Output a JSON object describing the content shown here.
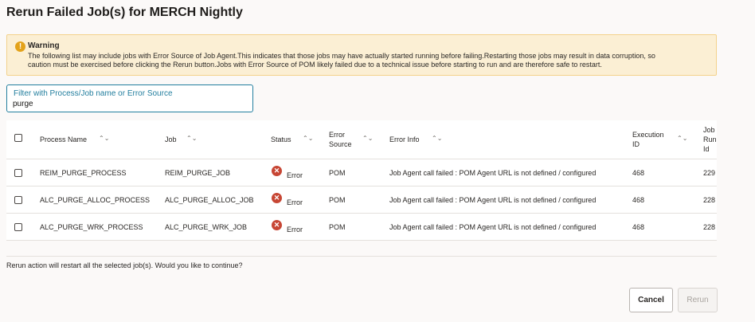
{
  "dialog": {
    "title": "Rerun Failed Job(s) for MERCH Nightly"
  },
  "warning": {
    "title": "Warning",
    "line1": "The following list may include jobs with Error Source of Job Agent.This indicates that those jobs may have actually started running before failing.Restarting those jobs may result in data corruption, so",
    "line2": "caution must be exercised before clicking the Rerun button.Jobs with Error Source of POM likely failed due to a technical issue before starting to run and are therefore safe to restart."
  },
  "filter": {
    "label": "Filter with Process/Job name or Error Source",
    "value": "purge"
  },
  "table": {
    "headers": {
      "process_name": "Process Name",
      "job": "Job",
      "status": "Status",
      "error_source_1": "Error",
      "error_source_2": "Source",
      "error_info": "Error Info",
      "execution_id_1": "Execution",
      "execution_id_2": "ID",
      "job_run_id_1": "Job",
      "job_run_id_2": "Run",
      "job_run_id_3": "Id"
    },
    "rows": [
      {
        "process_name": "REIM_PURGE_PROCESS",
        "job": "REIM_PURGE_JOB",
        "status": "Error",
        "error_source": "POM",
        "error_info": "Job Agent call failed : POM Agent URL is not defined / configured",
        "execution_id": "468",
        "job_run_id": "229"
      },
      {
        "process_name": "ALC_PURGE_ALLOC_PROCESS",
        "job": "ALC_PURGE_ALLOC_JOB",
        "status": "Error",
        "error_source": "POM",
        "error_info": "Job Agent call failed : POM Agent URL is not defined / configured",
        "execution_id": "468",
        "job_run_id": "228"
      },
      {
        "process_name": "ALC_PURGE_WRK_PROCESS",
        "job": "ALC_PURGE_WRK_JOB",
        "status": "Error",
        "error_source": "POM",
        "error_info": "Job Agent call failed : POM Agent URL is not defined / configured",
        "execution_id": "468",
        "job_run_id": "228"
      }
    ]
  },
  "confirm_text": "Rerun action will restart all the selected job(s). Would you like to continue?",
  "buttons": {
    "cancel": "Cancel",
    "rerun": "Rerun"
  },
  "icons": {
    "warning": "warning-icon",
    "error": "error-icon",
    "sort": "sort-icon"
  },
  "colors": {
    "warning_bg": "#fbefd4",
    "warning_icon": "#e3a21a",
    "error_icon": "#c74634",
    "filter_accent": "#227e9e"
  }
}
